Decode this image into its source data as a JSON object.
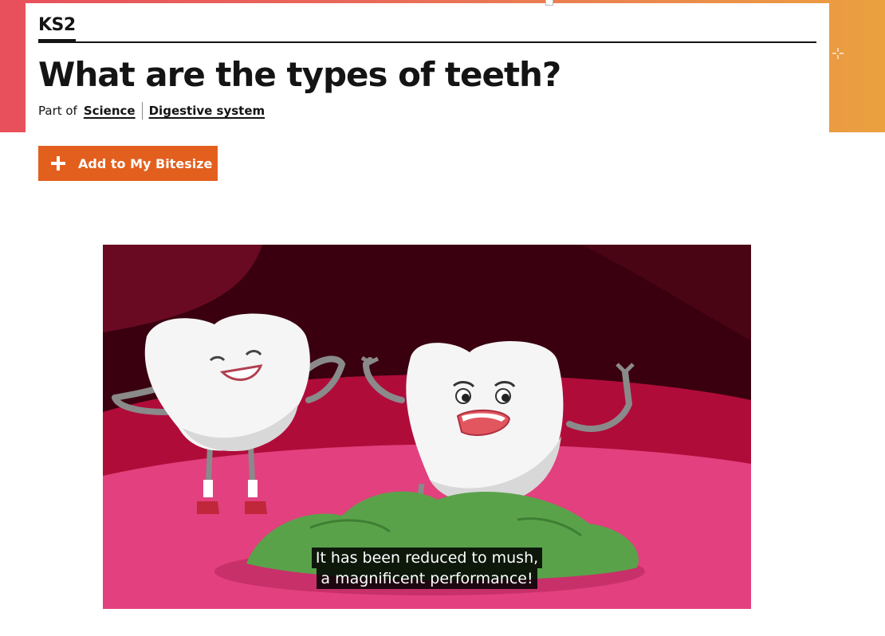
{
  "header": {
    "level": "KS2",
    "title": "What are the types of teeth?",
    "breadcrumb": {
      "prefix": "Part of",
      "links": [
        "Science",
        "Digestive system"
      ]
    }
  },
  "actions": {
    "add_label": "Add to My Bitesize"
  },
  "video": {
    "subtitle_lines": [
      "It has been reduced to mush,",
      "a magnificent performance!"
    ]
  },
  "colors": {
    "banner_start": "#e8505b",
    "banner_end": "#eba13f",
    "button": "#e35f1e",
    "text": "#141414"
  }
}
